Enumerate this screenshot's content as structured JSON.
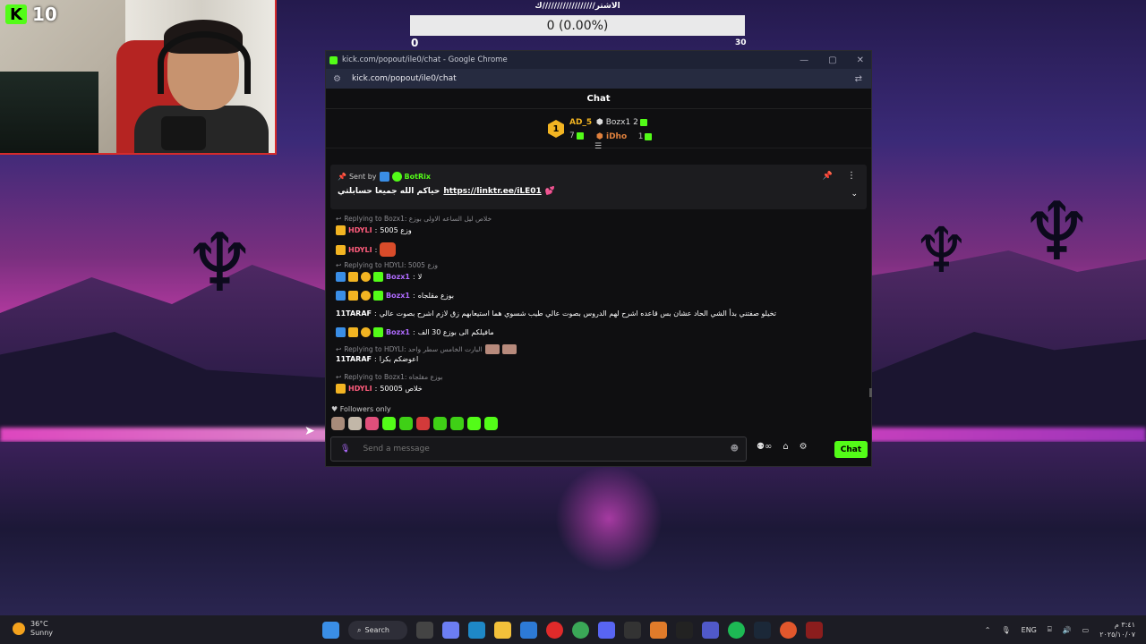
{
  "overlay": {
    "poll_title": "الاشتر//////////////////ك",
    "poll_value": "0 (0.00%)",
    "poll_min": "0",
    "poll_max": "30"
  },
  "webcam": {
    "viewer_count": "10"
  },
  "window": {
    "title": "kick.com/popout/ile0/chat - Google Chrome",
    "url": "kick.com/popout/ile0/chat",
    "controls": [
      "—",
      "▢",
      "✕"
    ]
  },
  "chat": {
    "header": "Chat",
    "leaderboard": {
      "first": {
        "rank": "1",
        "name": "AD_5",
        "count": "7"
      },
      "second": {
        "name": "Bozx1",
        "count": "2"
      },
      "third": {
        "name": "iDho",
        "count": "1"
      }
    },
    "pinned": {
      "sent_by_label": "Sent by",
      "sender": "BotRix",
      "text": "حياكم الله جميعا حسابلتي",
      "link": "https://linktr.ee/iLE01"
    },
    "messages": [
      {
        "type": "reply",
        "text": "Replying to Bozx1: خلاص ليل الساعه الاولى بوزع"
      },
      {
        "type": "msg",
        "user": "HDYLI",
        "body": "وزع 5005"
      },
      {
        "type": "msg",
        "user": "HDYLI",
        "body": ""
      },
      {
        "type": "reply",
        "text": "Replying to HDYLI: وزع 5005"
      },
      {
        "type": "msg",
        "user": "Bozx1",
        "body": "لا"
      },
      {
        "type": "msg",
        "user": "Bozx1",
        "body": "بوزع مقلجاه"
      },
      {
        "type": "msg",
        "user": "11TARAF",
        "body": "تخيلو صفتني بدأ الشي الحاد عشان بس قاعده اشرح لهم الدروس بصوت عالي طيب شسوي هما استيعابهم زق لازم اشرح بصوت عالي"
      },
      {
        "type": "msg",
        "user": "Bozx1",
        "body": "مافيلكم الى بوزع 30 الف"
      },
      {
        "type": "reply",
        "text": "Replying to HDYLI: البارت الخامس سطر واحد"
      },
      {
        "type": "msg",
        "user": "11TARAF",
        "body": "اعوضكم بكرا"
      },
      {
        "type": "reply",
        "text": "Replying to Bozx1: بوزع مقلجاه"
      },
      {
        "type": "msg",
        "user": "HDYLI",
        "body": "خلاص 50005"
      }
    ],
    "followers_only": "Followers only",
    "input_placeholder": "Send a message",
    "send_label": "Chat",
    "tool_infinity": "∞"
  },
  "taskbar": {
    "temperature": "36°C",
    "condition": "Sunny",
    "search_label": "Search",
    "language": "ENG",
    "time": "٣:٤١ م",
    "date": "٢٠٢٥/١٠/٠٧"
  },
  "colors": {
    "kick_green": "#53fc18",
    "gold": "#f2b422",
    "window_bg": "#0f0f11"
  }
}
